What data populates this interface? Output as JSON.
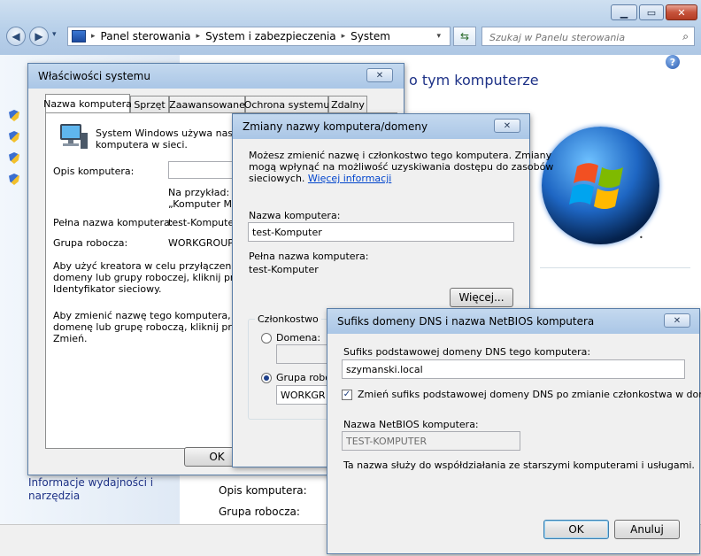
{
  "explorer": {
    "breadcrumb": [
      "Panel sterowania",
      "System i zabezpieczenia",
      "System"
    ],
    "search_placeholder": "Szukaj w Panelu sterowania",
    "header_partial": "o tym komputerze",
    "left_links": [
      "Informacje wydajności i",
      "narzędzia"
    ],
    "bottom_labels": [
      "Opis komputera:",
      "Grupa robocza:"
    ]
  },
  "system_props": {
    "title": "Właściwości systemu",
    "tabs": [
      "Nazwa komputera",
      "Sprzęt",
      "Zaawansowane",
      "Ochrona systemu",
      "Zdalny"
    ],
    "intro": [
      "System Windows używa następ",
      "komputera w sieci."
    ],
    "desc_label": "Opis komputera:",
    "example": [
      "Na przykład: „K",
      "„Komputer Mar"
    ],
    "fullname_label": "Pełna nazwa komputera:",
    "fullname_value": "test-Komputer",
    "workgroup_label": "Grupa robocza:",
    "workgroup_value": "WORKGROUP",
    "network_text": [
      "Aby użyć kreatora w celu przyłączenia się",
      "domeny lub grupy roboczej, kliknij przycisk",
      "Identyfikator sieciowy."
    ],
    "rename_text": [
      "Aby zmienić nazwę tego komputera, jego",
      "domenę lub grupę roboczą, kliknij przycisk",
      "Zmień."
    ],
    "ok_label": "OK"
  },
  "rename_dialog": {
    "title": "Zmiany nazwy komputera/domeny",
    "intro": [
      "Możesz zmienić nazwę i członkostwo tego komputera. Zmiany",
      "mogą wpłynąć na możliwość uzyskiwania dostępu do zasobów",
      "sieciowych."
    ],
    "more_info_link": "Więcej informacji",
    "name_label": "Nazwa komputera:",
    "name_value": "test-Komputer",
    "fullname_label": "Pełna nazwa komputera:",
    "fullname_value": "test-Komputer",
    "more_button": "Więcej...",
    "membership_label": "Członkostwo",
    "domain_label": "Domena:",
    "workgroup_label": "Grupa robocz",
    "workgroup_value": "WORKGRO"
  },
  "dns_dialog": {
    "title": "Sufiks domeny DNS i nazwa NetBIOS komputera",
    "suffix_label": "Sufiks podstawowej domeny DNS tego komputera:",
    "suffix_value": "szymanski.local",
    "change_checkbox_label": "Zmień sufiks podstawowej domeny DNS po zmianie członkostwa w domenie",
    "netbios_label": "Nazwa NetBIOS komputera:",
    "netbios_value": "TEST-KOMPUTER",
    "note": "Ta nazwa służy do współdziałania ze starszymi komputerami i usługami.",
    "ok_label": "OK",
    "cancel_label": "Anuluj"
  }
}
